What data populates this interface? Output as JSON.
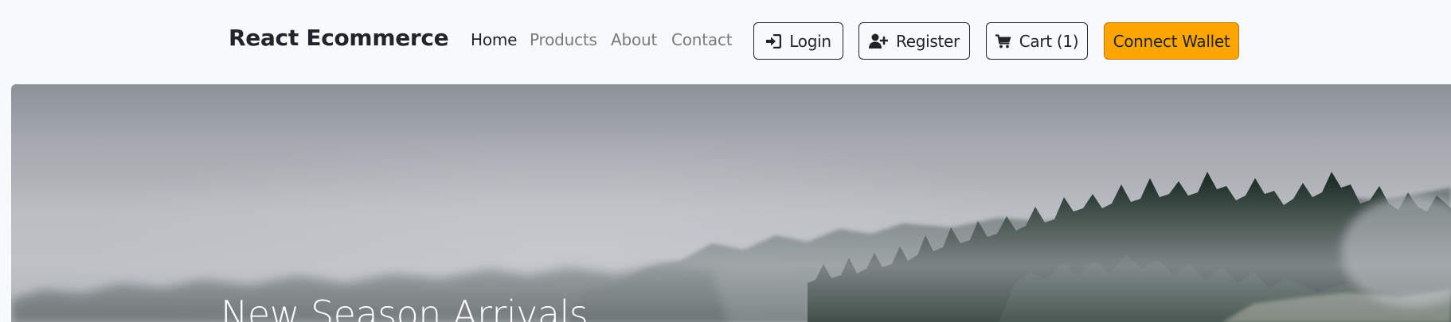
{
  "navbar": {
    "brand": "React Ecommerce",
    "links": [
      {
        "label": "Home",
        "active": true
      },
      {
        "label": "Products",
        "active": false
      },
      {
        "label": "About",
        "active": false
      },
      {
        "label": "Contact",
        "active": false
      }
    ],
    "buttons": {
      "login": {
        "label": "Login",
        "icon": "sign-in-icon"
      },
      "register": {
        "label": "Register",
        "icon": "user-plus-icon"
      },
      "cart": {
        "label": "Cart (1)",
        "icon": "shopping-cart-icon"
      },
      "wallet": {
        "label": "Connect Wallet",
        "color": "#ffa500"
      }
    }
  },
  "hero": {
    "title": "New Season Arrivals",
    "image": "misty-forest-image"
  }
}
